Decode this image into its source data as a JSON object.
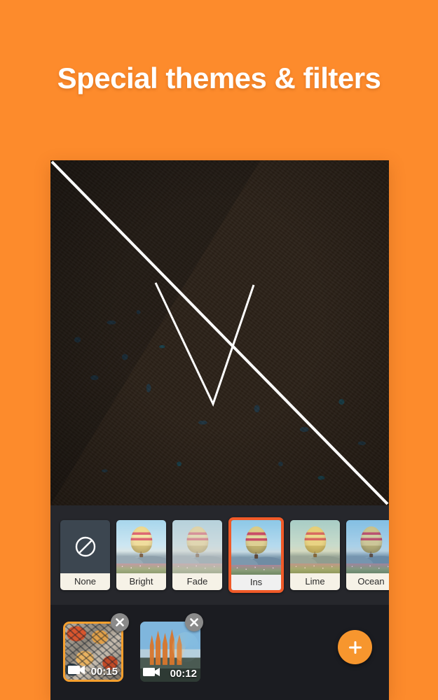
{
  "promo": {
    "headline": "Special themes & filters",
    "background_color": "#fd8b2c",
    "accent_color": "#f05a28"
  },
  "preview": {
    "name": "video-preview",
    "description": "Food photo with before/after filter split",
    "split_line_color": "#ffffff"
  },
  "filter_strip": {
    "background_color": "#26272c",
    "selected_index": 3,
    "tiles": [
      {
        "label": "None",
        "kind": "none"
      },
      {
        "label": "Bright",
        "kind": "balloon",
        "grade": "grade-bright"
      },
      {
        "label": "Fade",
        "kind": "balloon",
        "grade": "grade-fade"
      },
      {
        "label": "Ins",
        "kind": "balloon",
        "grade": "grade-ins"
      },
      {
        "label": "Lime",
        "kind": "balloon",
        "grade": "grade-lime"
      },
      {
        "label": "Ocean",
        "kind": "balloon",
        "grade": "grade-ocean"
      }
    ]
  },
  "timeline": {
    "background_color": "#1b1c21",
    "clips": [
      {
        "duration": "00:15",
        "thumb": "thumb-food",
        "selected": true,
        "close_label": "x"
      },
      {
        "duration": "00:12",
        "thumb": "thumb-cathedral",
        "selected": false,
        "close_label": "x"
      }
    ],
    "add_button": {
      "name": "add-clip-button",
      "glyph": "+",
      "color": "#f7962e"
    }
  },
  "icons": {
    "no_filter": "circle-slash-icon",
    "video": "video-camera-icon",
    "close": "close-icon",
    "plus": "plus-icon"
  }
}
